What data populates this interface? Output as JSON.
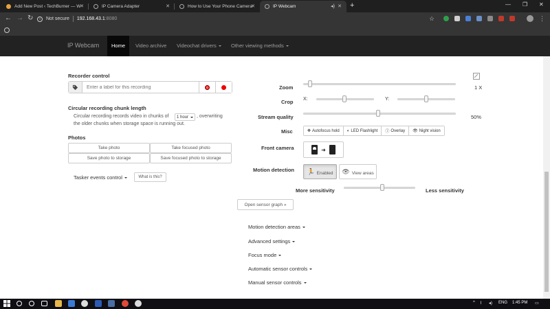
{
  "browser": {
    "tabs": [
      {
        "title": "Add New Post ‹ TechBurner — W",
        "favicon_color": "#e8a33d",
        "active": false
      },
      {
        "title": "IP Camera Adapter",
        "favicon_color": "#9aa0a6",
        "active": false
      },
      {
        "title": "How to Use Your Phone Camera",
        "favicon_color": "#9aa0a6",
        "active": false
      },
      {
        "title": "IP Webcam",
        "favicon_color": "#9aa0a6",
        "active": true
      }
    ],
    "new_tab_symbol": "+",
    "url": {
      "security_text": "Not secure",
      "host": "192.168.43.1",
      "port": ":8080"
    }
  },
  "navbar": {
    "brand": "IP Webcam",
    "items": [
      {
        "label": "Home",
        "active": true
      },
      {
        "label": "Video archive",
        "active": false
      },
      {
        "label": "Videochat drivers",
        "active": false,
        "dropdown": true
      },
      {
        "label": "Other viewing methods",
        "active": false,
        "dropdown": true
      }
    ]
  },
  "recorder": {
    "title": "Recorder control",
    "placeholder": "Enter a label for this recording"
  },
  "chunk": {
    "title": "Circular recording chunk length",
    "line1_prefix": "Circular recording records video in chunks of",
    "select_value": "1 hour",
    "line1_suffix": ", overwriting",
    "line2": "the older chunks when storage space is running out."
  },
  "photos": {
    "title": "Photos",
    "buttons": [
      "Take photo",
      "Take focused photo",
      "Save photo to storage",
      "Save focused photo to storage"
    ]
  },
  "tasker": {
    "label": "Tasker events control",
    "help_button": "What is this?"
  },
  "controls": {
    "zoom": {
      "label": "Zoom",
      "value": 0.03,
      "readout": "1 X"
    },
    "crop": {
      "label": "Crop",
      "x_label": "X:",
      "y_label": "Y:",
      "x_value": 0.5,
      "y_value": 0.5
    },
    "stream_quality": {
      "label": "Stream quality",
      "value": 0.5,
      "readout": "50%"
    },
    "misc": {
      "label": "Misc",
      "buttons": [
        "Autofocus hold",
        "LED Flashlight",
        "Overlay",
        "Night vision"
      ]
    },
    "front_camera": {
      "label": "Front camera"
    },
    "motion": {
      "label": "Motion detection",
      "enabled_button": "Enabled",
      "view_areas_button": "View areas",
      "more_label": "More sensitivity",
      "less_label": "Less sensitivity",
      "sensitivity": 0.5
    },
    "sensor_graph_button": "Open sensor graph »"
  },
  "collapsibles": [
    "Motion detection areas",
    "Advanced settings",
    "Focus mode",
    "Automatic sensor controls",
    "Manual sensor controls"
  ],
  "taskbar": {
    "language": "ENG",
    "time": "1:45 PM"
  },
  "colors": {
    "navbar_bg": "#222222",
    "nav_active_bg": "#080808",
    "record_red": "#ee0000",
    "browser_dark": "#353535"
  }
}
